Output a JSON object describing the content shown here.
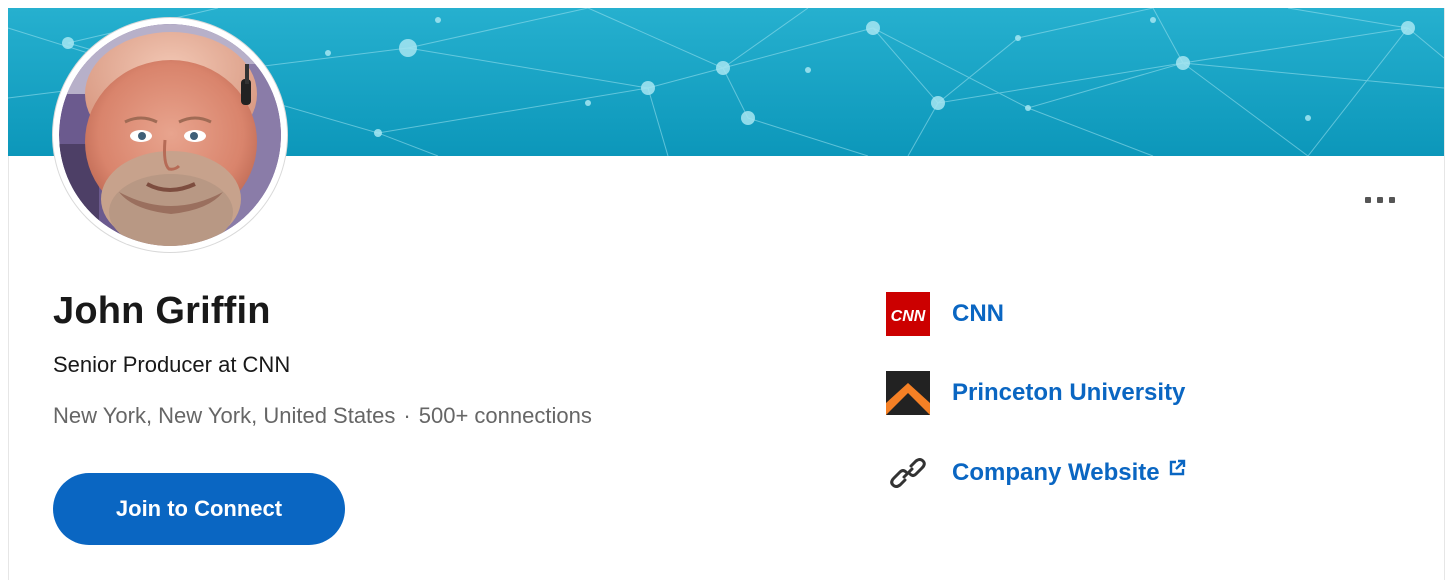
{
  "profile": {
    "name": "John Griffin",
    "headline": "Senior Producer at CNN",
    "location": "New York, New York, United States",
    "separator": "·",
    "connections": "500+ connections"
  },
  "actions": {
    "join_label": "Join to Connect",
    "more_icon": "more-horizontal-icon"
  },
  "side_links": [
    {
      "label": "CNN",
      "icon": "cnn-logo"
    },
    {
      "label": "Princeton University",
      "icon": "princeton-logo"
    },
    {
      "label": "Company Website",
      "icon": "link-icon"
    }
  ],
  "colors": {
    "accent": "#0a66c2",
    "banner": "#1fa3c4",
    "cnn_red": "#cc0000"
  },
  "logos": {
    "cnn_text": "CNN"
  }
}
